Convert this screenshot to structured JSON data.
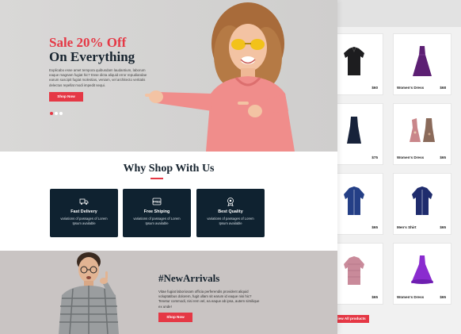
{
  "colors": {
    "accent": "#e53845",
    "dark": "#0f2230"
  },
  "hero": {
    "title_red": "Sale 20% Off",
    "title_dark": "On Everything",
    "text": "Explicabo esse amet tempora quibusdam laudantium, laborum eaque magnam fugiat hic? Esse dicta aliquid error repudiandae earum suscipit fugiat molestias, veniam, vel architecto veritatis delectus repellat modi impedit sequi.",
    "button": "Shop Now",
    "slides_active": 1,
    "slides_total": 3
  },
  "why": {
    "title": "Why Shop With Us",
    "features": [
      {
        "icon": "delivery-truck-icon",
        "title": "Fast Delivery",
        "desc": "variations of passages of Lorem Ipsum available"
      },
      {
        "icon": "free-shipping-icon",
        "title": "Free Shiping",
        "desc": "variations of passages of Lorem Ipsum available"
      },
      {
        "icon": "quality-badge-icon",
        "title": "Best Quality",
        "desc": "variations of passages of Lorem Ipsum available"
      }
    ]
  },
  "arrivals": {
    "title": "#NewArrivals",
    "text": "Vitae fugiat laboriosam officia perferendis provident aliquid voluptatibus dolorem, fugit ullam sit earum id eaque nisi hic? Tenetur commodi, nisi rem vel, ea eaque ab ipsa, autem similique ex unde!",
    "button": "Shop Now"
  },
  "products": [
    {
      "name": "irt",
      "price": "$60",
      "icon": "black-shirt-icon"
    },
    {
      "name": "Women's Dress",
      "price": "$68",
      "icon": "purple-dress-icon"
    },
    {
      "name": "Dress",
      "price": "$75",
      "icon": "navy-dress-icon"
    },
    {
      "name": "Women's Dress",
      "price": "$65",
      "icon": "floral-dress-icon"
    },
    {
      "name": "irt",
      "price": "$65",
      "icon": "blue-shirt-icon"
    },
    {
      "name": "Men's Shirt",
      "price": "$65",
      "icon": "navy-shirt-icon"
    },
    {
      "name": "irt",
      "price": "$65",
      "icon": "pink-shirt-icon"
    },
    {
      "name": "Women's Dress",
      "price": "$65",
      "icon": "purple-gown-icon"
    }
  ],
  "view_all": "iew All products"
}
